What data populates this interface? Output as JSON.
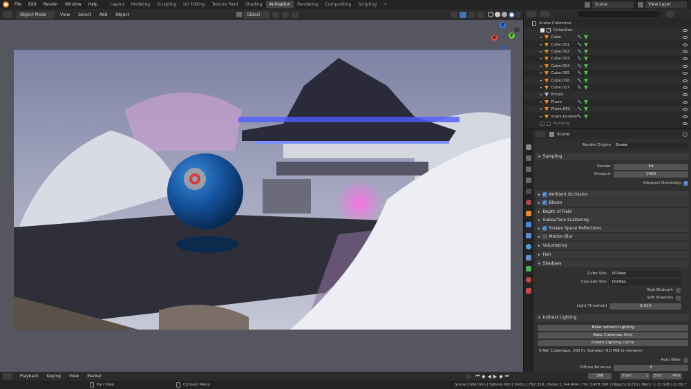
{
  "topbar": {
    "menus": [
      "File",
      "Edit",
      "Render",
      "Window",
      "Help"
    ],
    "workspaces": [
      "Layout",
      "Modeling",
      "Sculpting",
      "UV Editing",
      "Texture Paint",
      "Shading",
      "Animation",
      "Rendering",
      "Compositing",
      "Scripting"
    ],
    "active_workspace": "Animation",
    "add_tab": "+",
    "scene": "Scene",
    "view_layer": "View Layer"
  },
  "viewport_header": {
    "mode": "Object Mode",
    "menus": [
      "View",
      "Select",
      "Add",
      "Object"
    ],
    "orientation": "Global"
  },
  "gizmo": {
    "x": "X",
    "y": "Y",
    "z": "Z"
  },
  "outliner": {
    "root": "Scene Collection",
    "collection": "Collection",
    "items": [
      {
        "name": "Cube",
        "type": "mesh"
      },
      {
        "name": "Cube.001",
        "type": "mesh"
      },
      {
        "name": "Cube.002",
        "type": "mesh"
      },
      {
        "name": "Cube.003",
        "type": "mesh"
      },
      {
        "name": "Cube.004",
        "type": "mesh"
      },
      {
        "name": "Cube.005",
        "type": "mesh"
      },
      {
        "name": "Cube.016",
        "type": "mesh"
      },
      {
        "name": "Cube.017",
        "type": "mesh"
      },
      {
        "name": "Empty",
        "type": "empty"
      },
      {
        "name": "Plane",
        "type": "mesh"
      },
      {
        "name": "Plane.001",
        "type": "mesh"
      },
      {
        "name": "stairs.boolean",
        "type": "mesh"
      }
    ],
    "last_collection": "Building"
  },
  "properties": {
    "context": "Scene",
    "render_engine_label": "Render Engine",
    "render_engine": "Eevee",
    "sampling": {
      "title": "Sampling",
      "render_label": "Render",
      "render_value": "64",
      "viewport_label": "Viewport",
      "viewport_value": "1000",
      "denoise_label": "Viewport Denoising"
    },
    "panels": {
      "ambient_occlusion": "Ambient Occlusion",
      "bloom": "Bloom",
      "depth_of_field": "Depth of Field",
      "subsurface": "Subsurface Scattering",
      "ssr": "Screen Space Reflections",
      "motion_blur": "Motion Blur",
      "volumetrics": "Volumetrics",
      "hair": "Hair"
    },
    "shadows": {
      "title": "Shadows",
      "cube_size_label": "Cube Size",
      "cube_size": "1024px",
      "cascade_size_label": "Cascade Size",
      "cascade_size": "1024px",
      "high_bitdepth": "High Bitdepth",
      "soft_shadows": "Soft Shadows",
      "light_threshold_label": "Light Threshold",
      "light_threshold": "0.010"
    },
    "indirect": {
      "title": "Indirect Lighting",
      "bake_indirect": "Bake Indirect Lighting",
      "bake_cubemap": "Bake Cubemap Only",
      "delete_cache": "Delete Lighting Cache",
      "info": "0 Ref. Cubemaps, 200 Irr. Samples (9.0 MiB in memory)",
      "auto_bake": "Auto Bake",
      "diffuse_bounces_label": "Diffuse Bounces",
      "diffuse_bounces": "4"
    }
  },
  "timeline": {
    "menus": [
      "Playback",
      "Keying",
      "View",
      "Marker"
    ],
    "current_frame": "398",
    "start_label": "Start",
    "start": "1",
    "end_label": "End",
    "end": "499"
  },
  "statusbar": {
    "left_hint": "Pan View",
    "right_hint": "Context Menu",
    "stats": "Scene Collection | Sphere.000 | Verts:1,797,316 | Faces:1,744,404 | Tris:3,478,560 | Objects:1/216 | Mem: 1.11 GiB | v2.82.7"
  },
  "colors": {
    "accent": "#4772b3",
    "active_tab": "#454545",
    "panel": "#3a3a3a",
    "field": "#545454"
  }
}
